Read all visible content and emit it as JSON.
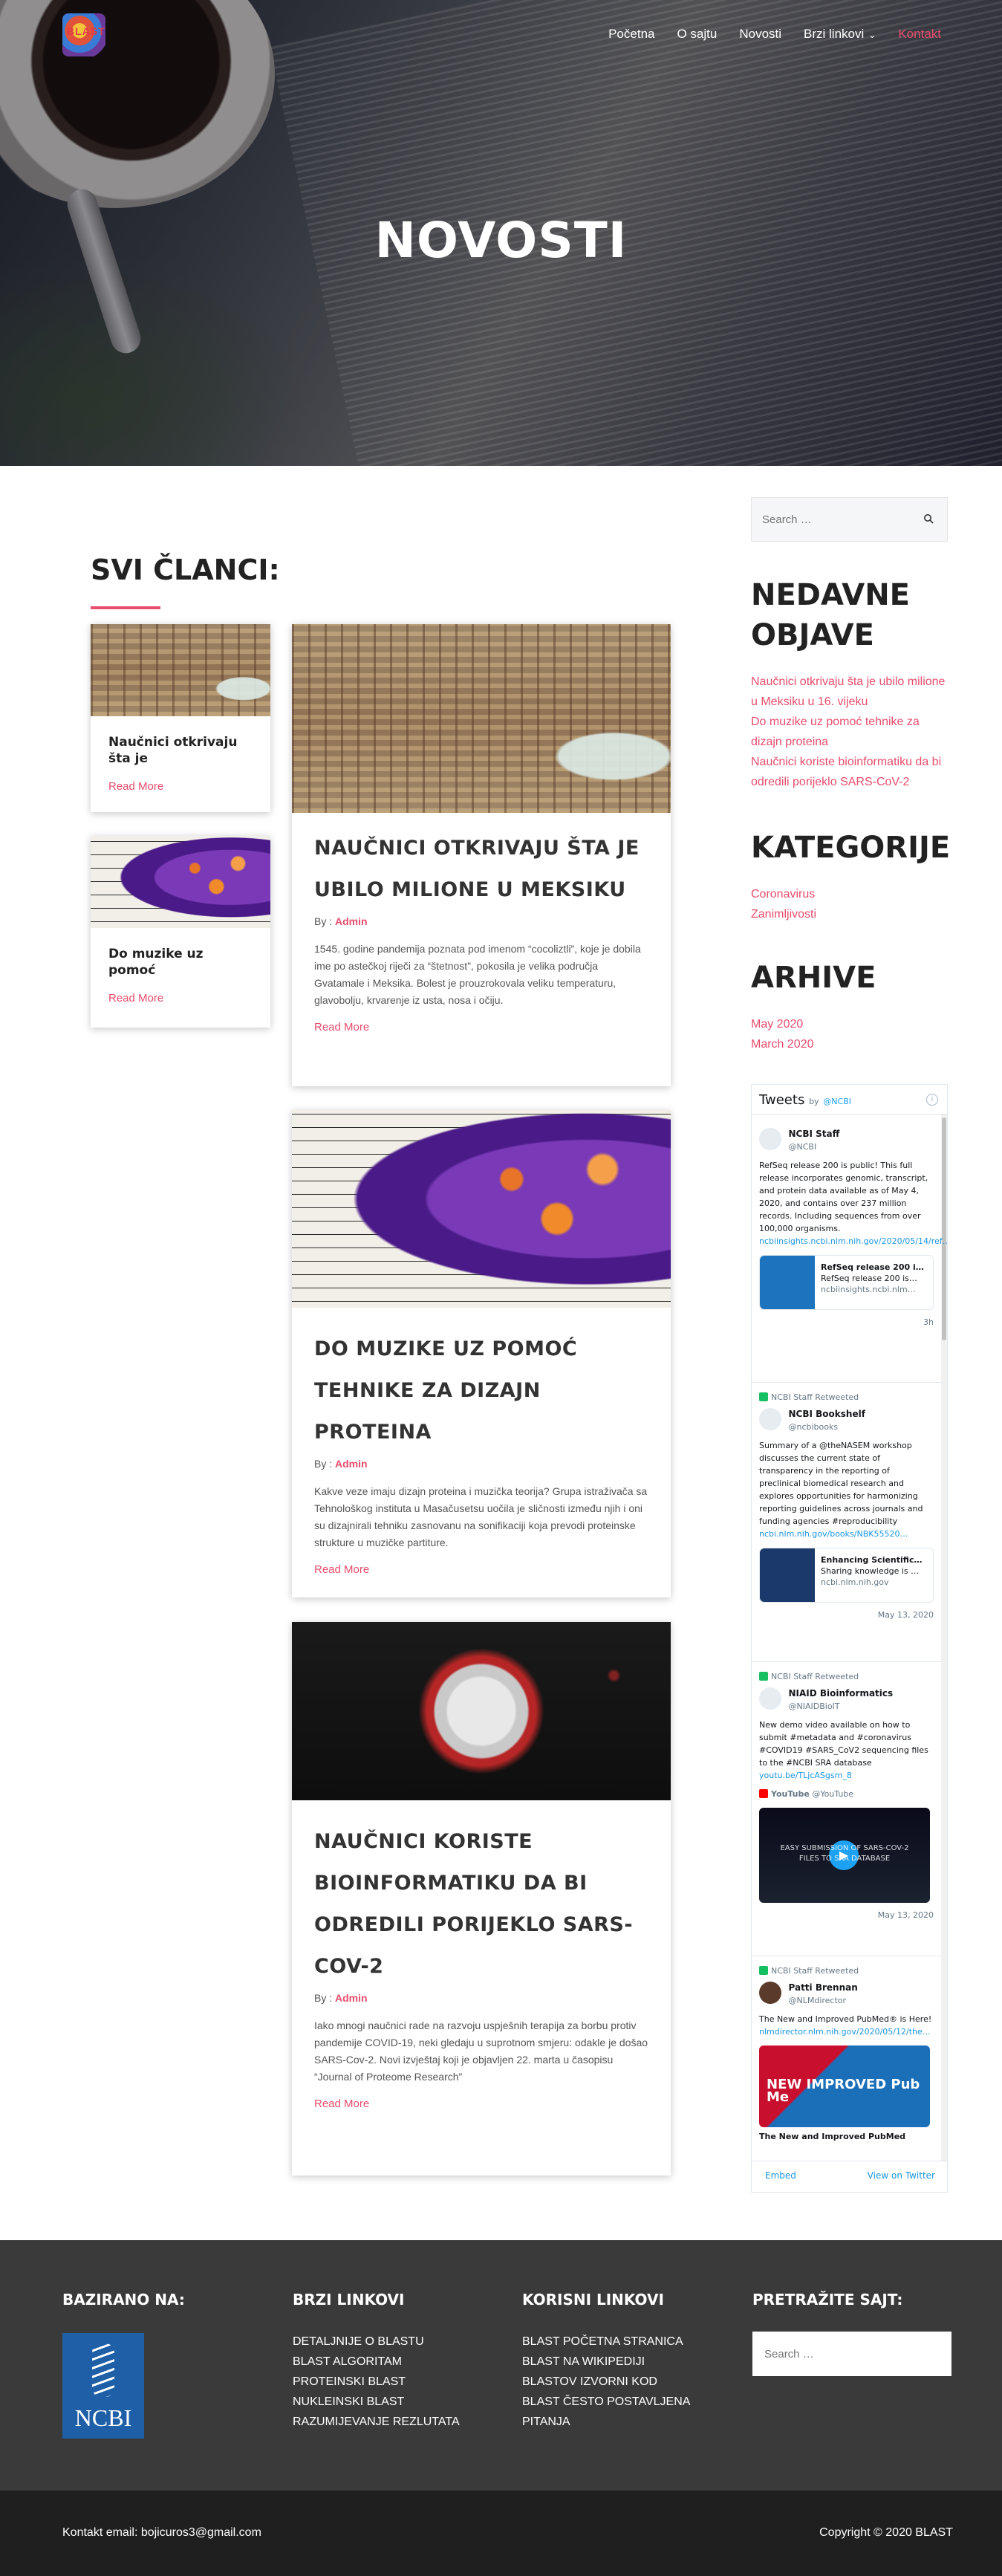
{
  "logo": {
    "text": "BLAST"
  },
  "nav": {
    "items": [
      {
        "label": "Početna"
      },
      {
        "label": "O sajtu"
      },
      {
        "label": "Novosti"
      },
      {
        "label": "Brzi linkovi"
      },
      {
        "label": "Kontakt"
      }
    ],
    "caret": "⌄"
  },
  "hero": {
    "title": "NOVOSTI"
  },
  "main": {
    "section_title": "SVI ČLANCI:",
    "small_cards": [
      {
        "title": "Naučnici otkrivaju šta je",
        "more": "Read More"
      },
      {
        "title": "Do muzike uz pomoć",
        "more": "Read More"
      }
    ],
    "articles": [
      {
        "title": "NAUČNICI OTKRIVAJU ŠTA JE UBILO MILIONE U MEKSIKU",
        "by_prefix": "By : ",
        "author": "Admin",
        "excerpt": "1545. godine pandemija poznata pod imenom “cocoliztli”, koje je dobila ime po astečkoj riječi za “štetnost”, pokosila je velika područja Gvatamale i Meksika. Bolest je prouzrokovala veliku temperaturu, glavobolju, krvarenje iz usta, nosa i očiju.",
        "more": "Read More"
      },
      {
        "title": "DO MUZIKE UZ POMOĆ TEHNIKE ZA DIZAJN PROTEINA",
        "by_prefix": "By : ",
        "author": "Admin",
        "excerpt": "Kakve veze imaju dizajn proteina i muzička teorija? Grupa istraživača sa Tehnološkog instituta u Masačusetsu uočila je sličnosti između njih i oni su dizajnirali tehniku zasnovanu na sonifikaciji koja prevodi proteinske strukture u muzičke partiture.",
        "more": "Read More"
      },
      {
        "title": "NAUČNICI KORISTE BIOINFORMATIKU DA BI ODREDILI PORIJEKLO SARS-COV-2",
        "by_prefix": "By : ",
        "author": "Admin",
        "excerpt": "Iako mnogi naučnici rade na razvoju uspješnih terapija za borbu protiv pandemije COVID-19, neki gledaju u suprotnom smjeru: odakle je došao SARS-Cov-2. Novi izvještaj koji je objavljen 22. marta u časopisu “Journal of Proteome Research”",
        "more": "Read More"
      }
    ]
  },
  "sidebar": {
    "search_placeholder": "Search …",
    "recent_title": "NEDAVNE OBJAVE",
    "recent": [
      "Naučnici otkrivaju šta je ubilo milione u Meksiku u 16. vijeku",
      "Do muzike uz pomoć tehnike za dizajn proteina",
      "Naučnici koriste bioinformatiku da bi odredili porijeklo SARS-CoV-2"
    ],
    "categories_title": "KATEGORIJE",
    "categories": [
      "Coronavirus",
      "Zanimljivosti"
    ],
    "archive_title": "ARHIVE",
    "archive": [
      "May 2020",
      "March 2020"
    ]
  },
  "twitter": {
    "title": "Tweets",
    "by": "by",
    "handle": "@NCBI",
    "info": "i",
    "tweets": [
      {
        "name": "NCBI Staff",
        "handle": "@NCBI",
        "body": "RefSeq release 200 is public! This full release incorporates genomic, transcript, and protein data available as of May 4, 2020, and contains over 237 million records. Including sequences from over 100,000 organisms.",
        "link": "ncbiinsights.ncbi.nlm.nih.gov/2020/05/14/ref…",
        "card_title": "RefSeq release 200 i…",
        "card_desc": "RefSeq release 200 is…",
        "card_site": "ncbiinsights.ncbi.nlm…",
        "date": "3h"
      },
      {
        "retweeted": "NCBI Staff Retweeted",
        "name": "NCBI Bookshelf",
        "handle": "@ncbibooks",
        "body": "Summary of a @theNASEM workshop discusses the current state of transparency in the reporting of preclinical biomedical research and explores opportunities for harmonizing reporting guidelines across journals and funding agencies #reproducibility",
        "link": "ncbi.nlm.nih.gov/books/NBK55520…",
        "card_title": "Enhancing Scientific…",
        "card_desc": "Sharing knowledge is …",
        "card_site": "ncbi.nlm.nih.gov",
        "date": "May 13, 2020"
      },
      {
        "retweeted": "NCBI Staff Retweeted",
        "name": "NIAID Bioinformatics",
        "handle": "@NIAIDBioIT",
        "body": "New demo video available on how to submit #metadata and #coronavirus #COVID19 #SARS_CoV2 sequencing files to the #NCBI SRA database",
        "link": "youtu.be/TLjcASgsm_8",
        "yt_name": "YouTube",
        "yt_handle": "@YouTube",
        "media_caption": "EASY SUBMISSION OF SARS-COV-2 FILES TO SRA DATABASE",
        "date": "May 13, 2020"
      },
      {
        "retweeted": "NCBI Staff Retweeted",
        "name": "Patti Brennan",
        "handle": "@NLMdirector",
        "body": "The New and Improved PubMed® is Here!",
        "link": "nlmdirector.nlm.nih.gov/2020/05/12/the…",
        "media_caption": "NEW IMPROVED Pub Me",
        "card_title": "The New and Improved PubMed"
      }
    ],
    "embed": "Embed",
    "view": "View on Twitter"
  },
  "footer": {
    "col1_title": "BAZIRANO NA:",
    "ncbi_logo": "NCBI",
    "col2_title": "BRZI LINKOVI",
    "col2": [
      "DETALJNIJE O BLASTU",
      "BLAST ALGORITAM",
      "PROTEINSKI BLAST",
      "NUKLEINSKI BLAST",
      "RAZUMIJEVANJE REZLUTATA"
    ],
    "col3_title": "KORISNI LINKOVI",
    "col3": [
      "BLAST POČETNA STRANICA",
      "BLAST NA WIKIPEDIJI",
      "BLASTOV IZVORNI KOD",
      "BLAST ČESTO POSTAVLJENA PITANJA"
    ],
    "col4_title": "PRETRAŽITE SAJT:",
    "search_placeholder": "Search …",
    "contact": "Kontakt email: bojicuros3@gmail.com",
    "copyright": "Copyright © 2020 BLAST"
  },
  "colors": {
    "accent": "#e84d6d",
    "footer_bg": "#3a3a3a",
    "bottom_bg": "#1f1f1f"
  }
}
